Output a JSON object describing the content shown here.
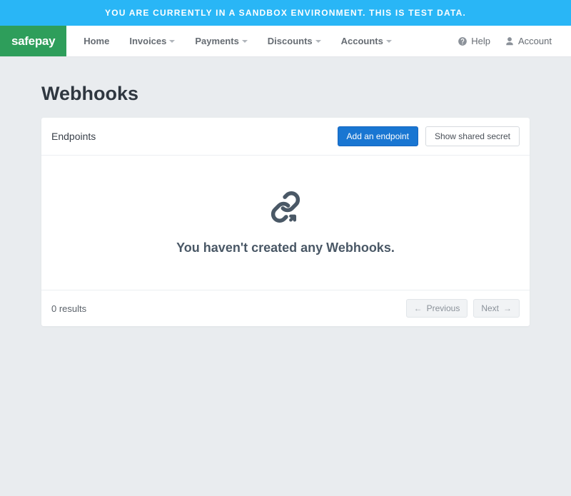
{
  "banner": {
    "text": "YOU ARE CURRENTLY IN A SANDBOX ENVIRONMENT. THIS IS TEST DATA."
  },
  "brand": {
    "name": "safepay"
  },
  "nav": {
    "items": [
      {
        "label": "Home",
        "caret": false
      },
      {
        "label": "Invoices",
        "caret": true
      },
      {
        "label": "Payments",
        "caret": true
      },
      {
        "label": "Discounts",
        "caret": true
      },
      {
        "label": "Accounts",
        "caret": true
      }
    ],
    "help": "Help",
    "account": "Account"
  },
  "page": {
    "title": "Webhooks",
    "section_title": "Endpoints",
    "add_endpoint": "Add an endpoint",
    "show_secret": "Show shared secret",
    "empty_message": "You haven't created any Webhooks.",
    "result_count": "0 results",
    "prev": "Previous",
    "next": "Next"
  }
}
